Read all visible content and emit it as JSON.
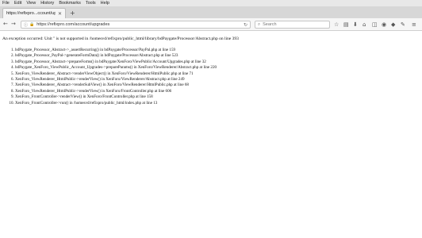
{
  "menu": [
    "File",
    "Edit",
    "View",
    "History",
    "Bookmarks",
    "Tools",
    "Help"
  ],
  "tab": {
    "title": "https://refixpro...ccount/upgrades"
  },
  "url": "https://refixpro.com/account/upgrades",
  "search": {
    "placeholder": "Search"
  },
  "error": {
    "message": "An exception occurred: Unit '' is not supported in /homesvd/refixpro/public_html/library/bdPaygate/Processor/Abstract.php on line 393",
    "trace": [
      "bdPaygate_Processor_Abstract->_assertRecurring() in bdPaygate/Processor/PayPal.php at line 159",
      "bdPaygate_Processor_PayPal->generateFormData() in bdPaygate/Processor/Abstract.php at line 523",
      "bdPaygate_Processor_Abstract->prepareForms() in bdPaygate/XenForo/ViewPublic/Account/Upgrades.php at line 32",
      "bdPaygate_XenForo_ViewPublic_Account_Upgrades->prepareParams() in XenForo/ViewRenderer/Abstract.php at line 220",
      "XenForo_ViewRenderer_Abstract->renderViewObject() in XenForo/ViewRenderer/HtmlPublic.php at line 71",
      "XenForo_ViewRenderer_HtmlPublic->renderView() in XenForo/ViewRenderer/Abstract.php at line 249",
      "XenForo_ViewRenderer_Abstract->renderSubView() in XenForo/ViewRenderer/HtmlPublic.php at line 68",
      "XenForo_ViewRenderer_HtmlPublic->renderView() in XenForo/FrontController.php at line 606",
      "XenForo_FrontController->renderView() in XenForo/FrontController.php at line 158",
      "XenForo_FrontController->run() in /homesvd/refixpro/public_html/index.php at line 13"
    ]
  }
}
